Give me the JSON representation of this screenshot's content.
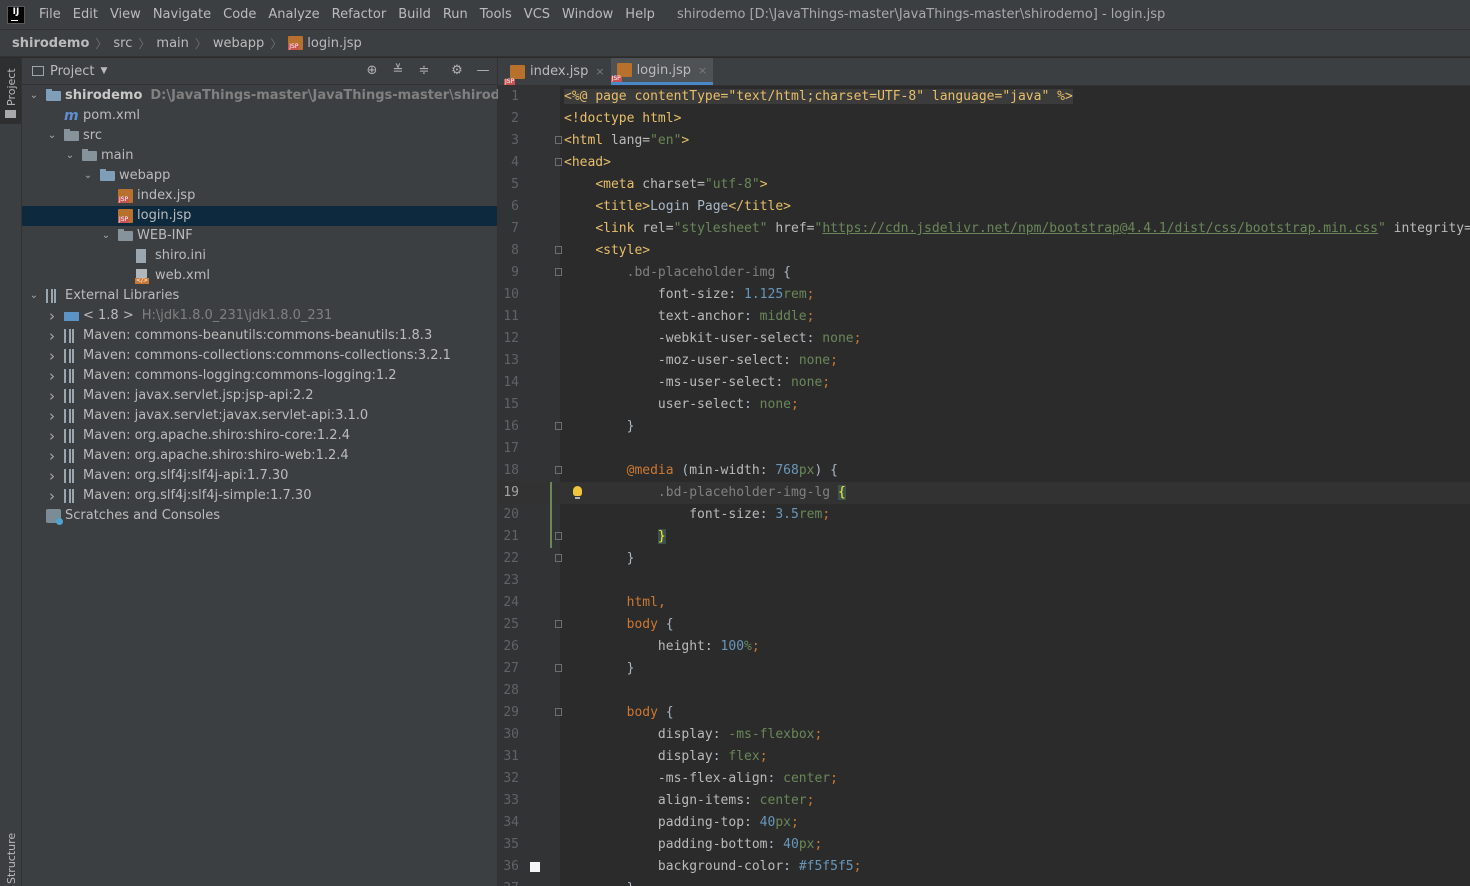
{
  "menubar": {
    "items": [
      "File",
      "Edit",
      "View",
      "Navigate",
      "Code",
      "Analyze",
      "Refactor",
      "Build",
      "Run",
      "Tools",
      "VCS",
      "Window",
      "Help"
    ],
    "window_title": "shirodemo [D:\\JavaThings-master\\JavaThings-master\\shirodemo] - login.jsp"
  },
  "navbar": {
    "crumbs": [
      "shirodemo",
      "src",
      "main",
      "webapp",
      "login.jsp"
    ]
  },
  "left_strip": {
    "project_label": "Project",
    "structure_label": "Structure"
  },
  "project_panel": {
    "title": "Project",
    "tree": [
      {
        "label": "shirodemo",
        "suffix": "D:\\JavaThings-master\\JavaThings-master\\shirodemo",
        "icon": "module-folder-icon",
        "depth": 0,
        "arrow": "down",
        "bold": true
      },
      {
        "label": "pom.xml",
        "icon": "maven-icon",
        "depth": 1,
        "arrow": ""
      },
      {
        "label": "src",
        "icon": "folder-icon",
        "depth": 1,
        "arrow": "down"
      },
      {
        "label": "main",
        "icon": "folder-icon",
        "depth": 2,
        "arrow": "down"
      },
      {
        "label": "webapp",
        "icon": "web-folder-icon",
        "depth": 3,
        "arrow": "down"
      },
      {
        "label": "index.jsp",
        "icon": "jsp-file-icon",
        "depth": 4,
        "arrow": ""
      },
      {
        "label": "login.jsp",
        "icon": "jsp-file-icon",
        "depth": 4,
        "arrow": "",
        "selected": true
      },
      {
        "label": "WEB-INF",
        "icon": "folder-icon",
        "depth": 4,
        "arrow": "down"
      },
      {
        "label": "shiro.ini",
        "icon": "text-file-icon",
        "depth": 5,
        "arrow": ""
      },
      {
        "label": "web.xml",
        "icon": "xml-file-icon",
        "depth": 5,
        "arrow": ""
      },
      {
        "label": "External Libraries",
        "icon": "library-icon",
        "depth": 0,
        "arrow": "down"
      },
      {
        "label": "< 1.8 >",
        "suffix": "H:\\jdk1.8.0_231\\jdk1.8.0_231",
        "icon": "jdk-icon",
        "depth": 1,
        "arrow": "right"
      },
      {
        "label": "Maven: commons-beanutils:commons-beanutils:1.8.3",
        "icon": "library-icon",
        "depth": 1,
        "arrow": "right"
      },
      {
        "label": "Maven: commons-collections:commons-collections:3.2.1",
        "icon": "library-icon",
        "depth": 1,
        "arrow": "right"
      },
      {
        "label": "Maven: commons-logging:commons-logging:1.2",
        "icon": "library-icon",
        "depth": 1,
        "arrow": "right"
      },
      {
        "label": "Maven: javax.servlet.jsp:jsp-api:2.2",
        "icon": "library-icon",
        "depth": 1,
        "arrow": "right"
      },
      {
        "label": "Maven: javax.servlet:javax.servlet-api:3.1.0",
        "icon": "library-icon",
        "depth": 1,
        "arrow": "right"
      },
      {
        "label": "Maven: org.apache.shiro:shiro-core:1.2.4",
        "icon": "library-icon",
        "depth": 1,
        "arrow": "right"
      },
      {
        "label": "Maven: org.apache.shiro:shiro-web:1.2.4",
        "icon": "library-icon",
        "depth": 1,
        "arrow": "right"
      },
      {
        "label": "Maven: org.slf4j:slf4j-api:1.7.30",
        "icon": "library-icon",
        "depth": 1,
        "arrow": "right"
      },
      {
        "label": "Maven: org.slf4j:slf4j-simple:1.7.30",
        "icon": "library-icon",
        "depth": 1,
        "arrow": "right"
      },
      {
        "label": "Scratches and Consoles",
        "icon": "scratches-icon",
        "depth": 0,
        "arrow": ""
      }
    ]
  },
  "editor": {
    "tabs": [
      {
        "label": "index.jsp",
        "active": false
      },
      {
        "label": "login.jsp",
        "active": true
      }
    ],
    "current_line": 19,
    "lines": [
      [
        [
          "<%@ ",
          "t-dir"
        ],
        [
          "page ",
          "t-dir t-kw"
        ],
        [
          "contentType=",
          "t-dir t-attr"
        ],
        [
          "\"text/html;charset=UTF-8\"",
          "t-dir t-val"
        ],
        [
          " language=",
          "t-dir t-attr"
        ],
        [
          "\"java\"",
          "t-dir t-val"
        ],
        [
          " %>",
          "t-dir"
        ]
      ],
      [
        [
          "<!doctype ",
          "t-tag"
        ],
        [
          "html",
          "t-tag"
        ],
        [
          ">",
          "t-tag"
        ]
      ],
      [
        [
          "<html ",
          "t-tag"
        ],
        [
          "lang=",
          "t-attr"
        ],
        [
          "\"en\"",
          "t-val"
        ],
        [
          ">",
          "t-tag"
        ]
      ],
      [
        [
          "<head>",
          "t-tag"
        ]
      ],
      [
        [
          "    ",
          ""
        ],
        [
          "<meta ",
          "t-tag"
        ],
        [
          "charset=",
          "t-attr"
        ],
        [
          "\"utf-8\"",
          "t-val"
        ],
        [
          ">",
          "t-tag"
        ]
      ],
      [
        [
          "    ",
          ""
        ],
        [
          "<title>",
          "t-tag"
        ],
        [
          "Login Page",
          ""
        ],
        [
          "</title>",
          "t-tag"
        ]
      ],
      [
        [
          "    ",
          ""
        ],
        [
          "<link ",
          "t-tag"
        ],
        [
          "rel=",
          "t-attr"
        ],
        [
          "\"stylesheet\"",
          "t-val"
        ],
        [
          " href=",
          "t-attr"
        ],
        [
          "\"",
          "t-val"
        ],
        [
          "https://cdn.jsdelivr.net/npm/bootstrap@4.4.1/dist/css/bootstrap.min.css",
          "t-url"
        ],
        [
          "\"",
          "t-val"
        ],
        [
          " integrity=",
          "t-attr"
        ]
      ],
      [
        [
          "    ",
          ""
        ],
        [
          "<style>",
          "t-tag"
        ]
      ],
      [
        [
          "        ",
          ""
        ],
        [
          ".bd-placeholder-img",
          "t-selg"
        ],
        [
          " {",
          ""
        ]
      ],
      [
        [
          "            ",
          ""
        ],
        [
          "font-size",
          "t-prop"
        ],
        [
          ": ",
          ""
        ],
        [
          "1.125",
          "t-num"
        ],
        [
          "rem",
          "t-val"
        ],
        [
          ";",
          "t-kw"
        ]
      ],
      [
        [
          "            ",
          ""
        ],
        [
          "text-anchor",
          "t-prop"
        ],
        [
          ": ",
          ""
        ],
        [
          "middle",
          "t-val"
        ],
        [
          ";",
          "t-kw"
        ]
      ],
      [
        [
          "            ",
          ""
        ],
        [
          "-webkit-user-select",
          "t-prop"
        ],
        [
          ": ",
          ""
        ],
        [
          "none",
          "t-val"
        ],
        [
          ";",
          "t-kw"
        ]
      ],
      [
        [
          "            ",
          ""
        ],
        [
          "-moz-user-select",
          "t-prop"
        ],
        [
          ": ",
          ""
        ],
        [
          "none",
          "t-val"
        ],
        [
          ";",
          "t-kw"
        ]
      ],
      [
        [
          "            ",
          ""
        ],
        [
          "-ms-user-select",
          "t-prop"
        ],
        [
          ": ",
          ""
        ],
        [
          "none",
          "t-val"
        ],
        [
          ";",
          "t-kw"
        ]
      ],
      [
        [
          "            ",
          ""
        ],
        [
          "user-select",
          "t-prop"
        ],
        [
          ": ",
          ""
        ],
        [
          "none",
          "t-val"
        ],
        [
          ";",
          "t-kw"
        ]
      ],
      [
        [
          "        }",
          ""
        ]
      ],
      [
        [
          "",
          ""
        ]
      ],
      [
        [
          "        ",
          ""
        ],
        [
          "@media",
          "t-at"
        ],
        [
          " (",
          ""
        ],
        [
          "min-width",
          "t-prop"
        ],
        [
          ": ",
          ""
        ],
        [
          "768",
          "t-num"
        ],
        [
          "px",
          "t-val"
        ],
        [
          ") {",
          ""
        ]
      ],
      [
        [
          "            ",
          ""
        ],
        [
          ".bd-placeholder-img-lg",
          "t-selg"
        ],
        [
          " ",
          ""
        ],
        [
          "{",
          "t-brace"
        ]
      ],
      [
        [
          "                ",
          ""
        ],
        [
          "font-size",
          "t-prop"
        ],
        [
          ": ",
          ""
        ],
        [
          "3.5",
          "t-num"
        ],
        [
          "rem",
          "t-val"
        ],
        [
          ";",
          "t-kw"
        ]
      ],
      [
        [
          "            ",
          ""
        ],
        [
          "}",
          "t-brace"
        ]
      ],
      [
        [
          "        }",
          ""
        ]
      ],
      [
        [
          "",
          ""
        ]
      ],
      [
        [
          "        ",
          ""
        ],
        [
          "html",
          "t-kw"
        ],
        [
          ",",
          "t-kw"
        ]
      ],
      [
        [
          "        ",
          ""
        ],
        [
          "body",
          "t-kw"
        ],
        [
          " {",
          ""
        ]
      ],
      [
        [
          "            ",
          ""
        ],
        [
          "height",
          "t-prop"
        ],
        [
          ": ",
          ""
        ],
        [
          "100",
          "t-num"
        ],
        [
          "%",
          "t-val"
        ],
        [
          ";",
          "t-kw"
        ]
      ],
      [
        [
          "        }",
          ""
        ]
      ],
      [
        [
          "",
          ""
        ]
      ],
      [
        [
          "        ",
          ""
        ],
        [
          "body",
          "t-kw"
        ],
        [
          " {",
          ""
        ]
      ],
      [
        [
          "            ",
          ""
        ],
        [
          "display",
          "t-prop"
        ],
        [
          ": ",
          ""
        ],
        [
          "-ms-flexbox",
          "t-val"
        ],
        [
          ";",
          "t-kw"
        ]
      ],
      [
        [
          "            ",
          ""
        ],
        [
          "display",
          "t-prop"
        ],
        [
          ": ",
          ""
        ],
        [
          "flex",
          "t-val"
        ],
        [
          ";",
          "t-kw"
        ]
      ],
      [
        [
          "            ",
          ""
        ],
        [
          "-ms-flex-align",
          "t-prop"
        ],
        [
          ": ",
          ""
        ],
        [
          "center",
          "t-val"
        ],
        [
          ";",
          "t-kw"
        ]
      ],
      [
        [
          "            ",
          ""
        ],
        [
          "align-items",
          "t-prop"
        ],
        [
          ": ",
          ""
        ],
        [
          "center",
          "t-val"
        ],
        [
          ";",
          "t-kw"
        ]
      ],
      [
        [
          "            ",
          ""
        ],
        [
          "padding-top",
          "t-prop"
        ],
        [
          ": ",
          ""
        ],
        [
          "40",
          "t-num"
        ],
        [
          "px",
          "t-val"
        ],
        [
          ";",
          "t-kw"
        ]
      ],
      [
        [
          "            ",
          ""
        ],
        [
          "padding-bottom",
          "t-prop"
        ],
        [
          ": ",
          ""
        ],
        [
          "40",
          "t-num"
        ],
        [
          "px",
          "t-val"
        ],
        [
          ";",
          "t-kw"
        ]
      ],
      [
        [
          "            ",
          ""
        ],
        [
          "background-color",
          "t-prop"
        ],
        [
          ": ",
          ""
        ],
        [
          "#f5f5f5",
          "t-num"
        ],
        [
          ";",
          "t-kw"
        ]
      ],
      [
        [
          "        }",
          ""
        ]
      ]
    ],
    "fold_lines": [
      3,
      4,
      8,
      9,
      16,
      18,
      21,
      22,
      25,
      27,
      29
    ],
    "bulb_line": 19,
    "swatch_line": 36,
    "swatch_color": "#f5f5f5"
  }
}
